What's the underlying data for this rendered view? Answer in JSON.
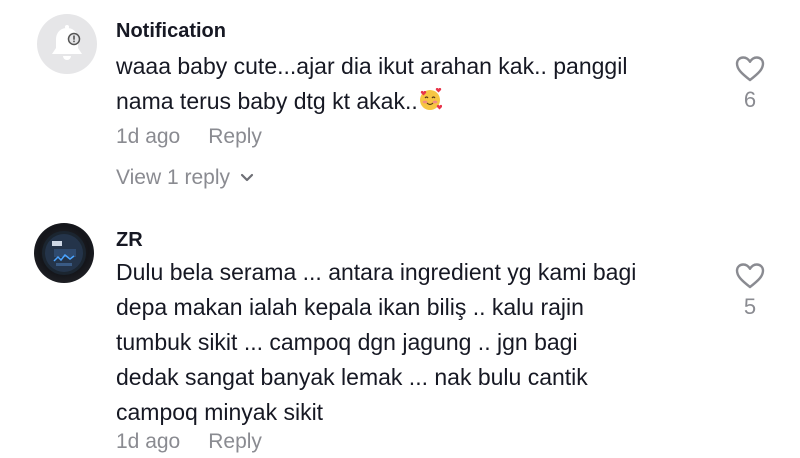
{
  "comments": [
    {
      "author": "Notification",
      "text_before_emoji": "waaa baby cute...ajar dia ikut arahan kak.. panggil\nnama terus baby dtg kt akak..",
      "emoji": "smiling-face-with-hearts",
      "time": "1d ago",
      "reply_label": "Reply",
      "view_replies_label": "View 1 reply",
      "like_count": "6"
    },
    {
      "author": "ZR",
      "text": "Dulu bela serama ... antara ingredient yg kami bagi\ndepa makan ialah kepala ikan biliş .. kalu rajin\ntumbuk sikit ... campoq dgn jagung .. jgn bagi\ndedak sangat banyak lemak ... nak bulu cantik\ncampoq minyak sikit",
      "time": "1d ago",
      "reply_label": "Reply",
      "like_count": "5"
    }
  ],
  "icons": {
    "avatar_notification": "bell-icon",
    "like": "heart-outline-icon",
    "view_replies": "chevron-down-icon"
  },
  "colors": {
    "text_primary": "#161823",
    "text_secondary": "#8a8b91",
    "bell_bg": "#e6e6e8"
  }
}
